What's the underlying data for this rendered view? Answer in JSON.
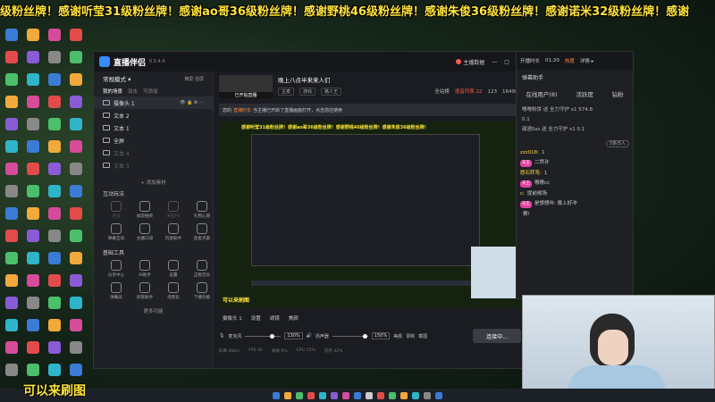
{
  "ticker": "级粉丝牌！感谢听莹31级粉丝牌！感谢ao哥36级粉丝牌！感谢野桃46级粉丝牌！感谢朱俊36级粉丝牌！感谢诺米32级粉丝牌！感谢",
  "app": {
    "title": "直播伴侣",
    "version": "6.5.4.4",
    "live_btn": "主播数据"
  },
  "sidebar": {
    "mode": "常规模式 ▾",
    "mode_right": "横屏  竖屏",
    "tabs": [
      "我的场景",
      "双击",
      "可添加"
    ],
    "sources": [
      {
        "label": "摄像头 1",
        "sel": true
      },
      {
        "label": "文本 2",
        "sel": false
      },
      {
        "label": "文本 1",
        "sel": false
      },
      {
        "label": "全屏",
        "sel": false
      },
      {
        "label": "文本 4",
        "dim": true
      },
      {
        "label": "文本 3",
        "dim": true
      }
    ],
    "add": "+ 添加素材",
    "section1": "互动玩法",
    "grid1": [
      {
        "label": "连线",
        "dim": true
      },
      {
        "label": "福袋抽奖",
        "dim": false
      },
      {
        "label": "发起PK",
        "dim": true
      },
      {
        "label": "礼物心愿",
        "dim": false
      },
      {
        "label": "弹幕互动",
        "dim": false
      },
      {
        "label": "主播口袋",
        "dim": false
      },
      {
        "label": "玩耍助手",
        "dim": false
      },
      {
        "label": "连麦点歌",
        "dim": false
      }
    ],
    "section2": "基础工具",
    "grid2": [
      {
        "label": "分享中心",
        "dim": false
      },
      {
        "label": "AI助手",
        "dim": false
      },
      {
        "label": "设置",
        "dim": false
      },
      {
        "label": "正版音乐",
        "dim": false
      },
      {
        "label": "弹幕员",
        "dim": false
      },
      {
        "label": "房管助手",
        "dim": false
      },
      {
        "label": "场景化",
        "dim": false
      },
      {
        "label": "下播功能",
        "dim": false
      }
    ],
    "more": "更多功能"
  },
  "main": {
    "thumb_caption": "已开始直播",
    "room_title": "晚上八点半来来人们",
    "chips": [
      "主麦",
      "游戏",
      "路人王"
    ],
    "stats": {
      "fans": "全站榜",
      "rank": "语音列表 22",
      "n1": "123",
      "n2": "164984"
    },
    "notice_prefix": "您的",
    "notice_highlight": "直播时长",
    "notice_text": "当主播已开启了直播画面打开，点击前往使用",
    "preview_bar": "感谢听莹31级粉丝牌！感谢ao哥36级粉丝牌！感谢野桃46级粉丝牌！感谢朱俊36级粉丝牌！",
    "preview_wm": "可以来刷图",
    "ctrl_tabs": [
      "摄像头 1",
      "设置",
      "滤镜",
      "美颜"
    ],
    "mic": "麦克风",
    "mic_pct": "130%",
    "speaker": "扬声器",
    "spk_pct": "150%",
    "extra": [
      "美颜",
      "录制",
      "截图"
    ],
    "start_btn": "连接中...",
    "status": [
      "码率 0kb/s",
      "FPS 30",
      "丢帧 0%",
      "CPU 15%",
      "内存 42%"
    ]
  },
  "danmu": {
    "top": [
      "开播时长",
      "01:20",
      "热度",
      "详情 ▸"
    ],
    "title": "弹幕助手",
    "tabs": [
      "在线用户(8)",
      "活跃度",
      "钻粉"
    ],
    "gifts": [
      "噜噜粉饼  送 全力守护 x1  574.8",
      "0.1",
      "甜酒Sss  送 全力守护  x1  0.1"
    ],
    "counter": "5条/5人",
    "messages": [
      {
        "user": "zzz018:",
        "text": "1"
      },
      {
        "user": "天王",
        "text": "二然许"
      },
      {
        "user": "愿石转弯:",
        "text": "1"
      },
      {
        "user": "天王",
        "text": "嗷嗷cc"
      },
      {
        "user": "c:",
        "text": "提前候场"
      },
      {
        "user": "天王",
        "text": "是想想咔: 晚上好冲"
      },
      {
        "user": "",
        "text": "赛!"
      }
    ]
  },
  "watermark": "可以来刷图"
}
